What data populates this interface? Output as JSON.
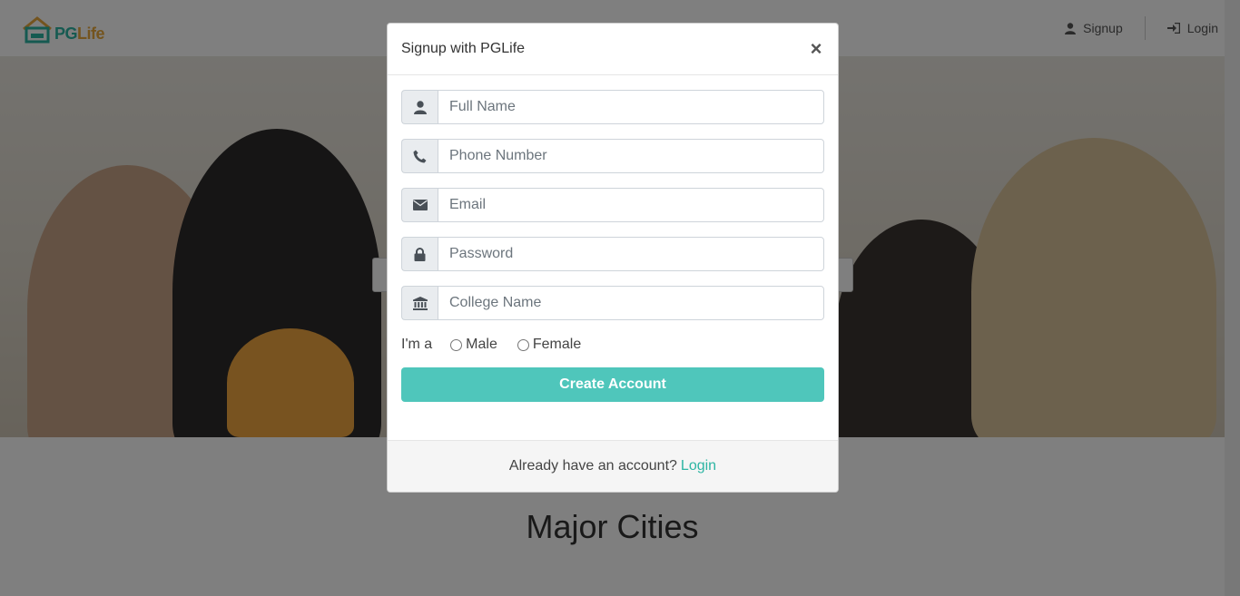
{
  "brand": {
    "name_pg": "PG",
    "name_life": "Life"
  },
  "nav": {
    "signup_label": "Signup",
    "login_label": "Login"
  },
  "main": {
    "section_title": "Major Cities"
  },
  "modal": {
    "title": "Signup with PGLife",
    "close_symbol": "×",
    "fields": [
      {
        "icon": "user-icon",
        "placeholder": "Full Name"
      },
      {
        "icon": "phone-icon",
        "placeholder": "Phone Number"
      },
      {
        "icon": "envelope-icon",
        "placeholder": "Email"
      },
      {
        "icon": "lock-icon",
        "placeholder": "Password"
      },
      {
        "icon": "university-icon",
        "placeholder": "College Name"
      }
    ],
    "gender": {
      "label": "I'm a",
      "options": [
        "Male",
        "Female"
      ]
    },
    "submit_label": "Create Account",
    "footer_text": "Already have an account?",
    "footer_link": "Login"
  },
  "colors": {
    "accent": "#4fc6bb",
    "link": "#2db5a3",
    "backdrop": "rgba(0,0,0,0.5)"
  }
}
